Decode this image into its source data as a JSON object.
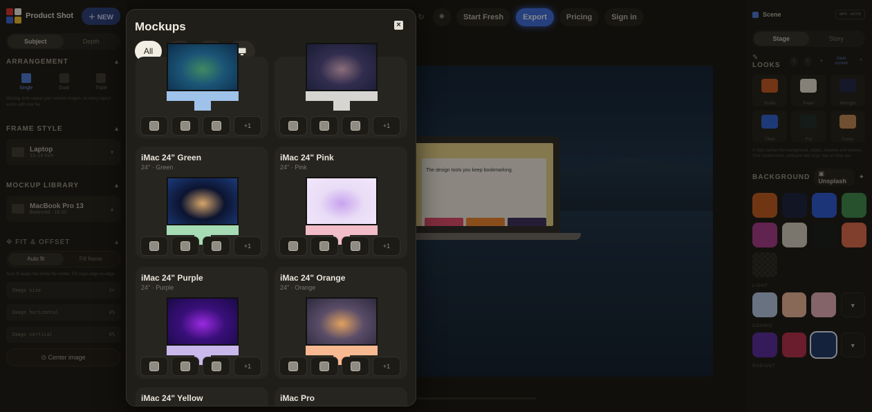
{
  "app": {
    "name": "Product Shot",
    "new_label": "NEW",
    "logo_colors": [
      "#e0312e",
      "#f2eee3",
      "#3b63d6",
      "#f4c02a"
    ]
  },
  "left": {
    "tabs": [
      "Subject",
      "Depth"
    ],
    "arrangement": {
      "title": "ARRANGEMENT",
      "options": [
        "Single",
        "Dual",
        "Triple"
      ],
      "hint": "Missing slots repeat your current images, so every layout works with one file."
    },
    "frame_style": {
      "title": "FRAME STYLE",
      "name": "Laptop",
      "sub": "13–16 inch"
    },
    "mockup_library": {
      "title": "MOCKUP LIBRARY",
      "name": "MacBook Pro 13",
      "sub": "Balanced · 16:10"
    },
    "fit": {
      "title": "FIT & OFFSET",
      "modes": [
        "Auto fit",
        "Fill frame"
      ],
      "hint": "Auto fit keeps the whole file visible. Fill crops edge-to-edge.",
      "sliders": [
        {
          "label": "Image size",
          "value": "1×"
        },
        {
          "label": "Image horizontal",
          "value": "0%"
        },
        {
          "label": "Image vertical",
          "value": "0%"
        }
      ],
      "center_label": "Center image"
    }
  },
  "topbar": {
    "start_fresh": "Start Fresh",
    "export": "Export",
    "pricing": "Pricing",
    "sign_in": "Sign in"
  },
  "canvas": {
    "laptop_headline": "The design tools you keep bookmarking.",
    "laptop_tile_colors": [
      "#e24b6a",
      "#f0882f",
      "#3a2f5c"
    ]
  },
  "right": {
    "scene": "Scene",
    "badge": "MPX · 4X7PS",
    "tabs": [
      "Stage",
      "Story"
    ],
    "looks_title": "LOOKS",
    "save_current": "Save current",
    "looks": [
      {
        "name": "Studio",
        "color": "#c65a22"
      },
      {
        "name": "Paper",
        "color": "#e9e4d6"
      },
      {
        "name": "Midnight",
        "color": "#1c2544"
      },
      {
        "name": "Tilted",
        "color": "#2f62d4"
      },
      {
        "name": "Flat",
        "color": "#1d2a28"
      },
      {
        "name": "Dunes",
        "color": "#c48a52"
      }
    ],
    "looks_hint": "A style carries the background, edges, shadow and camera. Your screenshots, artboard and copy stay as they are.",
    "background_title": "BACKGROUND",
    "unsplash_label": "Unsplash",
    "backgrounds": [
      "#c45b1f",
      "#18213d",
      "#2a5ad8",
      "#3e8a4c",
      "#a8398b",
      "#d5d0c3",
      "#161c18",
      "#e06a4b"
    ],
    "light_title": "LIGHT",
    "light": [
      "#b7c9e6",
      "#efb699",
      "#e7b0bb"
    ],
    "cosmic_title": "COSMIC",
    "cosmic": [
      "#5a2aa0",
      "#b82e4b",
      "#1d3a66"
    ],
    "radiant_title": "RADIANT"
  },
  "modal": {
    "title": "Mockups",
    "filters": [
      "All",
      "phone-icon",
      "laptop-icon",
      "monitor-icon"
    ],
    "more_label": "+1",
    "items": [
      {
        "name": "",
        "sub": "",
        "body": "#9ec2ea",
        "screen": [
          "#1b5476",
          "#3f8a63",
          "#0d2d49"
        ]
      },
      {
        "name": "",
        "sub": "",
        "body": "#d6d5d2",
        "screen": [
          "#312d4f",
          "#8b6d7a",
          "#1a1c33"
        ]
      },
      {
        "name": "iMac 24\" Green",
        "sub": "24\" · Green",
        "body": "#a5dcb5",
        "screen": [
          "#0c1430",
          "#d8a66a",
          "#1c3a7a"
        ]
      },
      {
        "name": "iMac 24\" Pink",
        "sub": "24\" · Pink",
        "body": "#f2bcc8",
        "screen": [
          "#e9dcf6",
          "#c7a3ee",
          "#f2e7fb"
        ]
      },
      {
        "name": "iMac 24\" Purple",
        "sub": "24\" · Purple",
        "body": "#c9b8ec",
        "screen": [
          "#3a0f7a",
          "#9a2ae0",
          "#1a0a48"
        ]
      },
      {
        "name": "iMac 24\" Orange",
        "sub": "24\" · Orange",
        "body": "#f7b992",
        "screen": [
          "#5a4d68",
          "#e0a160",
          "#2e2a3e"
        ]
      },
      {
        "name": "iMac 24\" Yellow",
        "sub": "",
        "body": "#f2d477",
        "screen": [
          "#f0c73d",
          "#e07a2b",
          "#f6e29b"
        ]
      },
      {
        "name": "iMac Pro",
        "sub": "",
        "body": "#4a4a4e",
        "screen": [
          "#1f2a44",
          "#3e5b8a",
          "#0e1424"
        ]
      }
    ]
  }
}
